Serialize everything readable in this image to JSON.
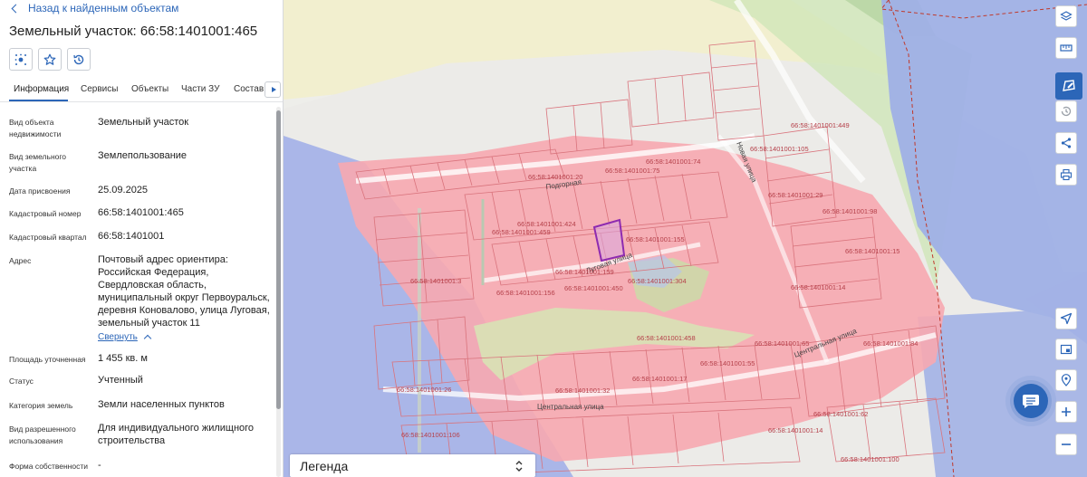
{
  "panel": {
    "back_link": "Назад к найденным объектам",
    "title": "Земельный участок: 66:58:1401001:465",
    "tabs": [
      {
        "label": "Информация"
      },
      {
        "label": "Сервисы"
      },
      {
        "label": "Объекты"
      },
      {
        "label": "Части ЗУ"
      },
      {
        "label": "Состав"
      }
    ],
    "props": {
      "type": {
        "label": "Вид объекта недвижимости",
        "value": "Земельный участок"
      },
      "land_kind": {
        "label": "Вид земельного участка",
        "value": "Землепользование"
      },
      "date": {
        "label": "Дата присвоения",
        "value": "25.09.2025"
      },
      "cadnum": {
        "label": "Кадастровый номер",
        "value": "66:58:1401001:465"
      },
      "quarter": {
        "label": "Кадастровый квартал",
        "value": "66:58:1401001"
      },
      "address": {
        "label": "Адрес",
        "value": "Почтовый адрес ориентира: Российская Федерация, Свердловская область, муниципальный округ Первоуральск, деревня Коновалово, улица Луговая, земельный участок 11"
      },
      "area": {
        "label": "Площадь уточненная",
        "value": "1 455 кв. м"
      },
      "status": {
        "label": "Статус",
        "value": "Учтенный"
      },
      "category": {
        "label": "Категория земель",
        "value": "Земли населенных пунктов"
      },
      "usage": {
        "label": "Вид разрешенного использования",
        "value": "Для индивидуального жилищного строительства"
      },
      "ownership": {
        "label": "Форма собственности",
        "value": "-"
      }
    },
    "collapse_label": "Свернуть"
  },
  "map": {
    "legend_label": "Легенда",
    "streets": [
      "Подгорная",
      "Новая улица",
      "Центральная улица",
      "Центральная улица",
      "Луговая улица"
    ],
    "parcel_labels": [
      "66:58:1401001:20",
      "66:58:1401001:75",
      "66:58:1401001:74",
      "66:58:1401001:424",
      "66:58:1401001:459",
      "66:58:1401001:159",
      "66:58:1401001:155",
      "66:58:1401001:304",
      "66:58:1401001:450",
      "66:58:1401001:156",
      "66:58:1401001:3",
      "66:58:1401001:458",
      "66:58:1401001:55",
      "66:58:1401001:17",
      "66:58:1401001:32",
      "66:58:1401001:26",
      "66:58:1401001:65",
      "66:58:1401001:84",
      "66:58:1401001:62",
      "66:58:1401001:14",
      "66:58:1401001:106",
      "66:58:1401001:100",
      "66:58:1401001:98",
      "66:58:1401001:29",
      "66:58:1401001:105",
      "66:58:1401001:449",
      "66:58:1401001:14",
      "66:58:1401001:15"
    ],
    "colors": {
      "settlement": "#f7a8b0",
      "water": "#9fb0e6",
      "parcel_stroke": "#d9737c",
      "selected": "#8e2bb0",
      "accent": "#2c66b8"
    }
  }
}
